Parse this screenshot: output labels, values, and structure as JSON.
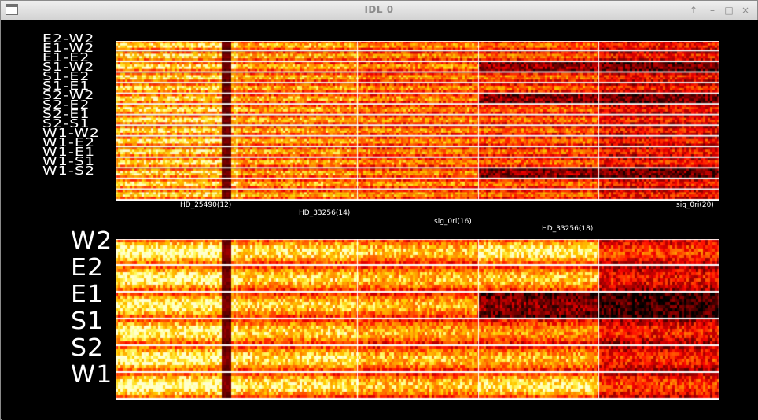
{
  "window": {
    "title": "IDL 0",
    "buttons": {
      "up": "↑",
      "minimize": "–",
      "maximize": "□",
      "close": "×"
    }
  },
  "top_panel": {
    "labels": [
      "E2-W2",
      "E1-W2",
      "E1-E2",
      "S1-W2",
      "S1-E2",
      "S1-E1",
      "S2-W2",
      "S2-E2",
      "S2-E1",
      "S2-S1",
      "W1-W2",
      "W1-E2",
      "W1-E1",
      "W1-S1",
      "W1-S2"
    ]
  },
  "bottom_panel": {
    "labels": [
      "W2",
      "E2",
      "E1",
      "S1",
      "S2",
      "W1"
    ]
  },
  "targets": [
    "HD_25490(12)",
    "HD_33256(14)",
    "sig_0ri(16)",
    "HD_33256(18)",
    "sig_0ri(20)"
  ],
  "colormap": "red-temperature",
  "colors": {
    "background": "#000000",
    "separator": "#ffffff",
    "label": "#ffffff"
  }
}
